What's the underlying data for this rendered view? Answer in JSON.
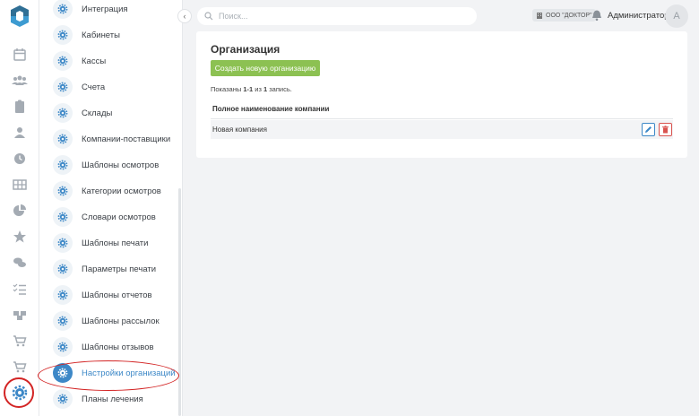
{
  "search": {
    "placeholder": "Поиск..."
  },
  "header": {
    "organization_badge": "ООО \"ДОКТОР\"",
    "user_name": "Администратор",
    "avatar_initial": "A"
  },
  "settings_menu": {
    "items": [
      {
        "label": "Интеграция",
        "active": false
      },
      {
        "label": "Кабинеты",
        "active": false
      },
      {
        "label": "Кассы",
        "active": false
      },
      {
        "label": "Счета",
        "active": false
      },
      {
        "label": "Склады",
        "active": false
      },
      {
        "label": "Компании-поставщики",
        "active": false
      },
      {
        "label": "Шаблоны осмотров",
        "active": false
      },
      {
        "label": "Категории осмотров",
        "active": false
      },
      {
        "label": "Словари осмотров",
        "active": false
      },
      {
        "label": "Шаблоны печати",
        "active": false
      },
      {
        "label": "Параметры печати",
        "active": false
      },
      {
        "label": "Шаблоны отчетов",
        "active": false
      },
      {
        "label": "Шаблоны рассылок",
        "active": false
      },
      {
        "label": "Шаблоны отзывов",
        "active": false
      },
      {
        "label": "Настройки организаций",
        "active": true
      },
      {
        "label": "Планы лечения",
        "active": false
      }
    ]
  },
  "page": {
    "title": "Организация",
    "create_button": "Создать новую организацию",
    "summary_prefix": "Показаны ",
    "summary_range": "1-1",
    "summary_mid": " из ",
    "summary_total": "1",
    "summary_suffix": " запись.",
    "table": {
      "columns": [
        "Полное наименование компании"
      ],
      "rows": [
        {
          "name": "Новая компания"
        }
      ]
    }
  },
  "colors": {
    "accent": "#3d88c7",
    "success": "#8cc152",
    "danger": "#d9534f",
    "highlight_ring": "#d32424"
  }
}
